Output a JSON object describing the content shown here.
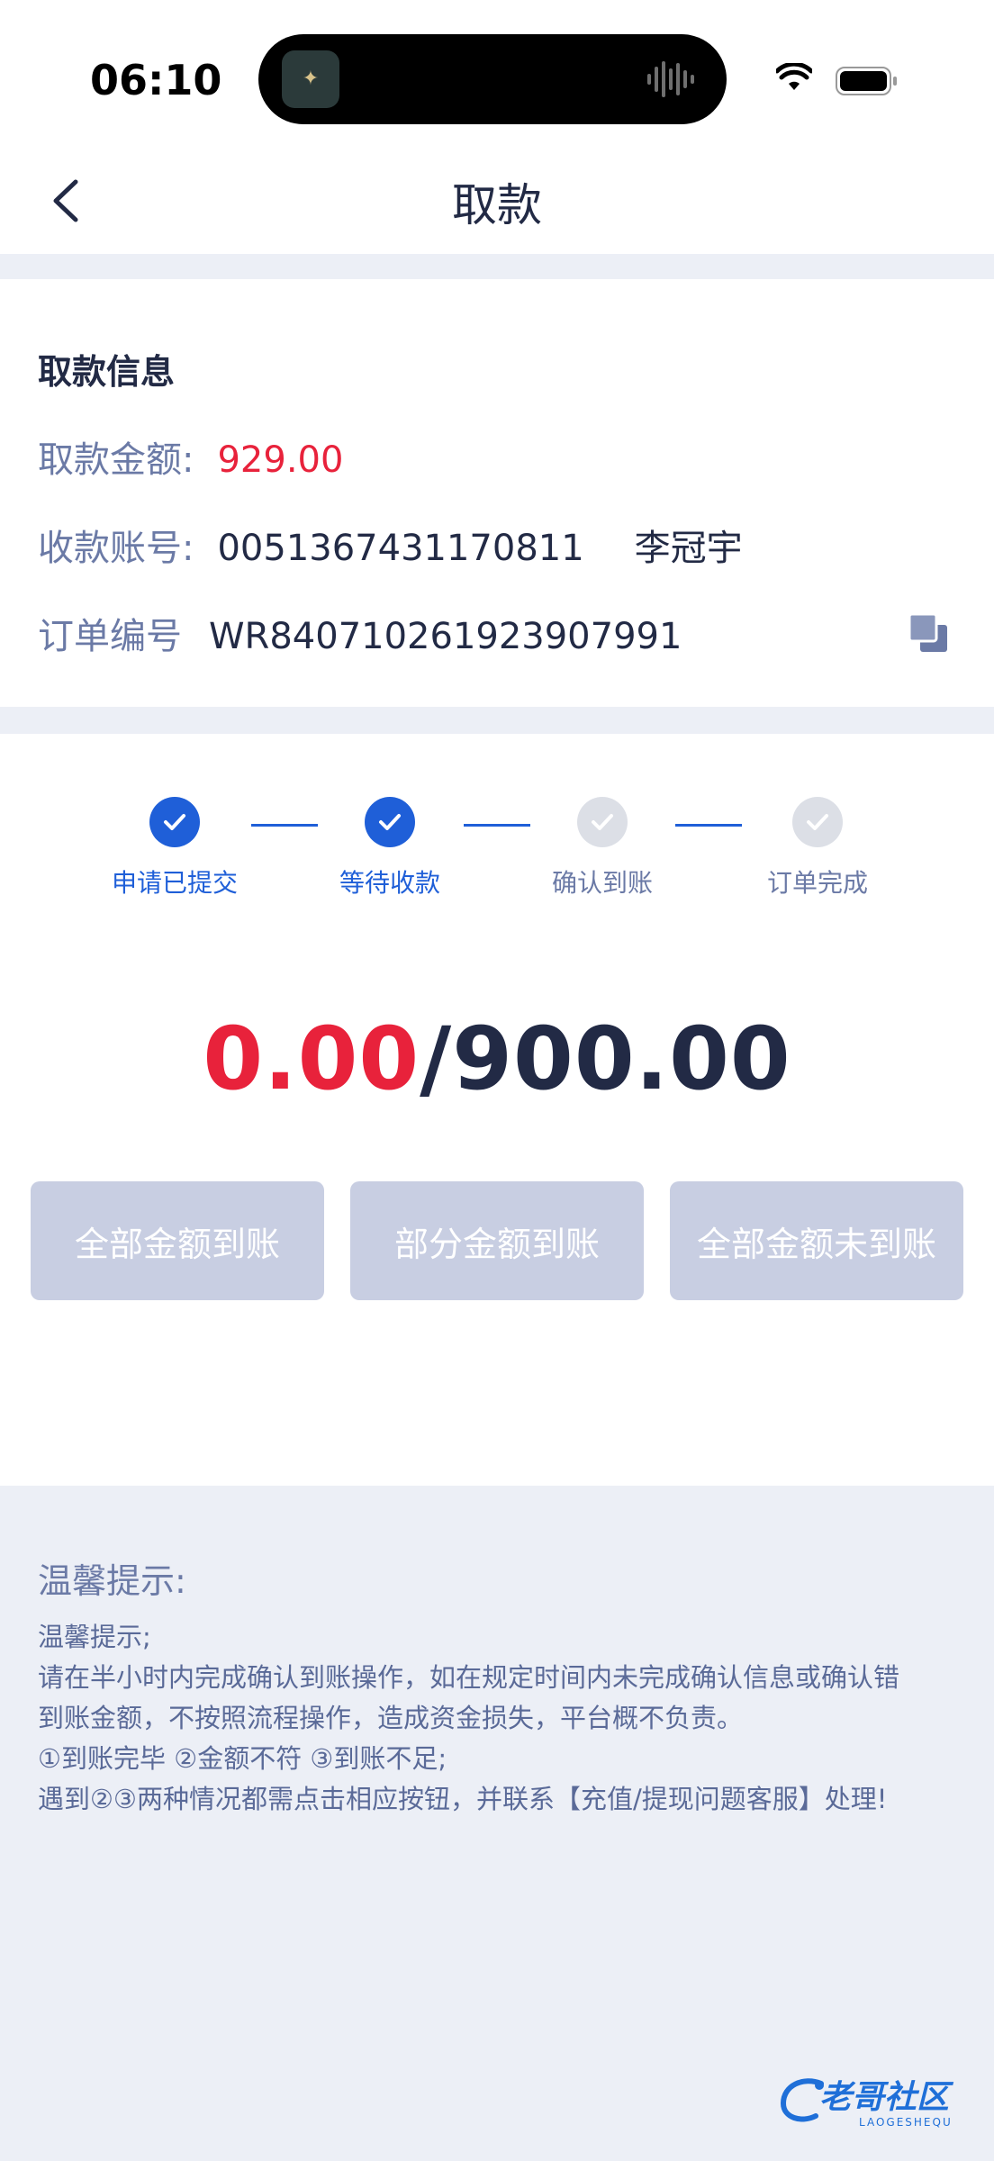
{
  "status_bar": {
    "time": "06:10",
    "colors": {
      "background": "#ffffff",
      "text": "#000000"
    }
  },
  "nav": {
    "title": "取款",
    "back_icon": "chevron-left-icon"
  },
  "withdraw_info": {
    "section_title": "取款信息",
    "amount_label": "取款金额:",
    "amount_value": "929.00",
    "account_label": "收款账号:",
    "account_number": "0051367431170811",
    "account_holder": "李冠宇",
    "order_label": "订单编号",
    "order_number": "WR840710261923907991",
    "copy_icon": "copy-icon"
  },
  "progress": {
    "steps": [
      {
        "label": "申请已提交",
        "status": "done"
      },
      {
        "label": "等待收款",
        "status": "done"
      },
      {
        "label": "确认到账",
        "status": "todo"
      },
      {
        "label": "订单完成",
        "status": "todo"
      }
    ],
    "received": "0.00",
    "separator": "/",
    "total": "900.00"
  },
  "actions": {
    "full_received": "全部金额到账",
    "partial_received": "部分金额到账",
    "not_received": "全部金额未到账"
  },
  "tips": {
    "title": "温馨提示:",
    "lines": [
      "温馨提示;",
      "请在半小时内完成确认到账操作，如在规定时间内未完成确认信息或确认错",
      "到账金额，不按照流程操作，造成资金损失，平台概不负责。",
      "①到账完毕 ②金额不符 ③到账不足;",
      "遇到②③两种情况都需点击相应按钮，并联系【充值/提现问题客服】处理!"
    ]
  },
  "watermark": {
    "text": "老哥社区",
    "subtext": "LAOGESHEQU"
  },
  "colors": {
    "accent": "#1f5fd8",
    "alert_red": "#e8223b",
    "page_bg": "#eceff6",
    "disabled_button": "#c8cee2",
    "label_gray": "#6b7aa6"
  }
}
